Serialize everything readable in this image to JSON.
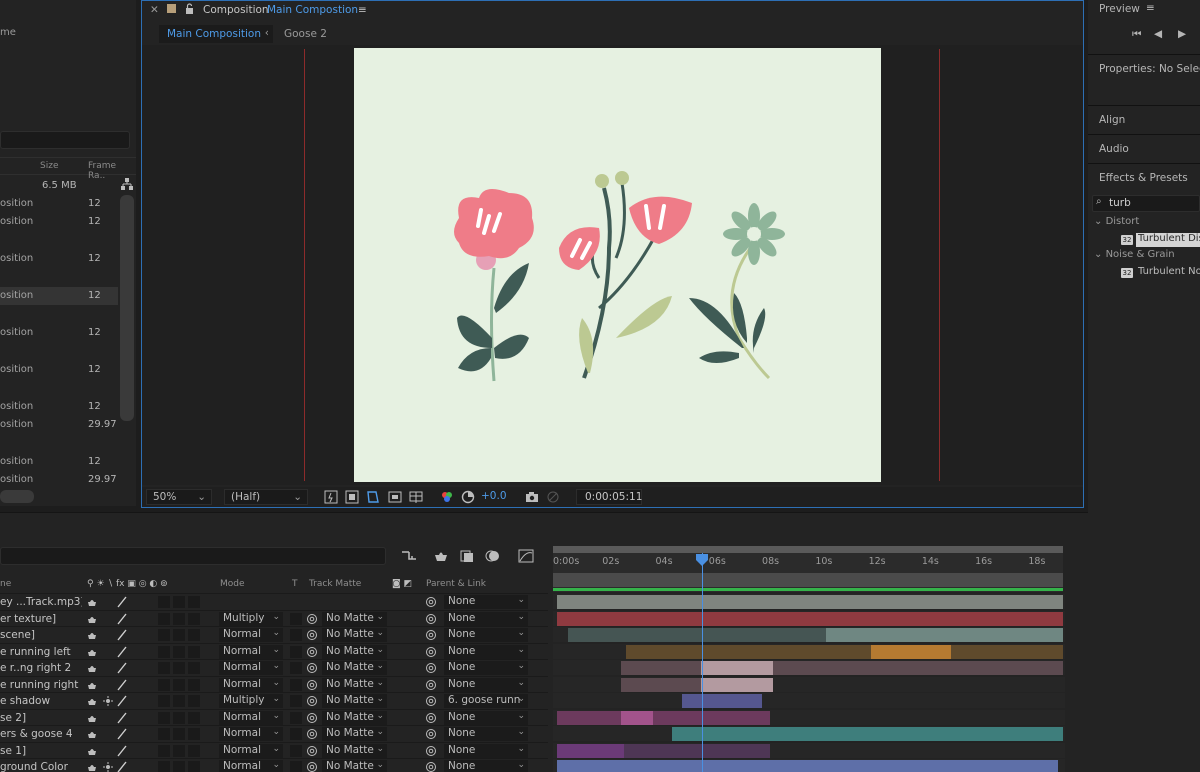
{
  "project": {
    "name_header_fragment": "me",
    "columns": {
      "size": "Size",
      "frame_rate": "Frame Ra.."
    },
    "rows": [
      {
        "name": "",
        "size": "6.5 MB",
        "rate": ""
      },
      {
        "name": "osition",
        "size": "",
        "rate": "12"
      },
      {
        "name": "osition",
        "size": "",
        "rate": "12"
      },
      {
        "name": "osition",
        "size": "",
        "rate": "12"
      },
      {
        "name": "osition",
        "size": "",
        "rate": "12"
      },
      {
        "name": "osition",
        "size": "",
        "rate": "12"
      },
      {
        "name": "osition",
        "size": "",
        "rate": "12"
      },
      {
        "name": "osition",
        "size": "",
        "rate": "12"
      },
      {
        "name": "osition",
        "size": "",
        "rate": "29.97"
      },
      {
        "name": "osition",
        "size": "",
        "rate": "12"
      },
      {
        "name": "osition",
        "size": "",
        "rate": "29.97"
      }
    ]
  },
  "viewer": {
    "panel_label": "Composition",
    "comp_name": "Main Compostion",
    "subtabs": [
      "Main Composition",
      "Goose 2"
    ],
    "zoom": "50%",
    "resolution": "(Half)",
    "exposure": "+0.0",
    "timecode": "0:00:05:11"
  },
  "right": {
    "preview": "Preview",
    "properties": "Properties: No Select",
    "align": "Align",
    "audio": "Audio",
    "effects": "Effects & Presets",
    "search_value": "turb",
    "groups": [
      {
        "name": "Distort",
        "item": "Turbulent Dis"
      },
      {
        "name": "Noise & Grain",
        "item": "Turbulent No"
      }
    ],
    "badge": "32"
  },
  "timeline": {
    "headers": {
      "name": "ne",
      "mode": "Mode",
      "t": "T",
      "track_matte": "Track Matte",
      "parent": "Parent & Link"
    },
    "ticks": [
      "0:00s",
      "02s",
      "04s",
      "06s",
      "08s",
      "10s",
      "12s",
      "14s",
      "16s",
      "18s"
    ],
    "playhead_seconds": 5.46,
    "duration_seconds": 19,
    "layers": [
      {
        "name": "ey ...Track.mp3]",
        "mode": "",
        "matte": "",
        "parent": "None",
        "bars": [
          {
            "start": 0.0,
            "end": 19.0,
            "color": "#7f857f"
          }
        ]
      },
      {
        "name": "er texture]",
        "mode": "Multiply",
        "matte": "No Matte",
        "parent": "None",
        "bars": [
          {
            "start": 0.0,
            "end": 19.0,
            "color": "#8f3a40"
          }
        ]
      },
      {
        "name": " scene]",
        "mode": "Normal",
        "matte": "No Matte",
        "parent": "None",
        "bars": [
          {
            "start": 0.4,
            "end": 10.1,
            "color": "#455553"
          },
          {
            "start": 10.1,
            "end": 19.0,
            "color": "#6f8782"
          }
        ]
      },
      {
        "name": "e running left",
        "mode": "Normal",
        "matte": "No Matte",
        "parent": "None",
        "bars": [
          {
            "start": 2.6,
            "end": 11.8,
            "color": "#5f4a2c"
          },
          {
            "start": 11.8,
            "end": 14.8,
            "color": "#b57a31"
          },
          {
            "start": 14.8,
            "end": 19.0,
            "color": "#5f4a2c"
          }
        ]
      },
      {
        "name": "e r..ng right 2",
        "mode": "Normal",
        "matte": "No Matte",
        "parent": "None",
        "bars": [
          {
            "start": 2.4,
            "end": 5.4,
            "color": "#5c4a50"
          },
          {
            "start": 5.4,
            "end": 8.1,
            "color": "#b39aa0"
          },
          {
            "start": 8.1,
            "end": 19.0,
            "color": "#5c4a50"
          }
        ]
      },
      {
        "name": "e running right",
        "mode": "Normal",
        "matte": "No Matte",
        "parent": "None",
        "bars": [
          {
            "start": 2.4,
            "end": 5.4,
            "color": "#5c4a50"
          },
          {
            "start": 5.4,
            "end": 8.1,
            "color": "#b39aa0"
          }
        ]
      },
      {
        "name": "e shadow",
        "mode": "Multiply",
        "matte": "No Matte",
        "parent": "6. goose runn",
        "bars": [
          {
            "start": 4.7,
            "end": 7.7,
            "color": "#55578f"
          }
        ]
      },
      {
        "name": "se 2]",
        "mode": "Normal",
        "matte": "No Matte",
        "parent": "None",
        "bars": [
          {
            "start": 0.0,
            "end": 2.4,
            "color": "#6c3a5d"
          },
          {
            "start": 2.4,
            "end": 3.6,
            "color": "#a2538b"
          },
          {
            "start": 3.6,
            "end": 8.0,
            "color": "#6c3a5d"
          }
        ]
      },
      {
        "name": "ers & goose 4",
        "mode": "Normal",
        "matte": "No Matte",
        "parent": "None",
        "bars": [
          {
            "start": 4.3,
            "end": 19.0,
            "color": "#3e7e7c"
          }
        ]
      },
      {
        "name": "se 1]",
        "mode": "Normal",
        "matte": "No Matte",
        "parent": "None",
        "bars": [
          {
            "start": 0.0,
            "end": 2.5,
            "color": "#6b3a78"
          },
          {
            "start": 2.5,
            "end": 8.0,
            "color": "#4e3655"
          }
        ]
      },
      {
        "name": "ground Color",
        "mode": "Normal",
        "matte": "No Matte",
        "parent": "None",
        "bars": [
          {
            "start": 0.0,
            "end": 18.8,
            "color": "#5e6fa8"
          }
        ]
      }
    ]
  },
  "colors": {
    "accent": "#4e9be8",
    "frame_border": "#2d6fb5",
    "canvas": "#e6f1e1",
    "work_area_green": "#35b34a"
  }
}
